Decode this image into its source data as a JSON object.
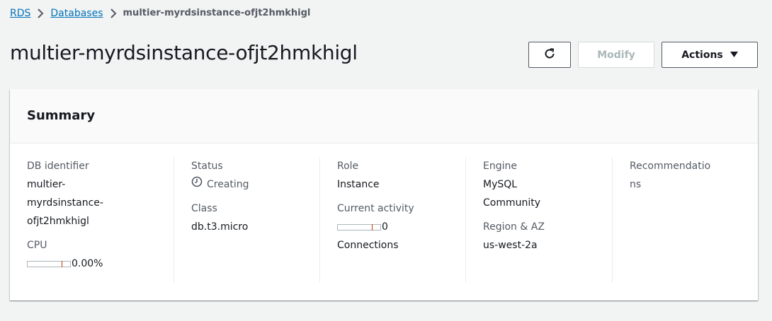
{
  "breadcrumb": {
    "items": [
      "RDS",
      "Databases"
    ],
    "current": "multier-myrdsinstance-ofjt2hmkhigl"
  },
  "page_title": "multier-myrdsinstance-ofjt2hmkhigl",
  "toolbar": {
    "refresh_icon": "refresh-icon",
    "modify_label": "Modify",
    "actions_label": "Actions"
  },
  "summary": {
    "title": "Summary",
    "db_identifier": {
      "label": "DB identifier",
      "lines": [
        "multier-",
        "myrdsinstance-",
        "ofjt2hmkhigl"
      ]
    },
    "cpu": {
      "label": "CPU",
      "value": "0.00%",
      "percent": 0
    },
    "status": {
      "label": "Status",
      "value": "Creating",
      "icon": "clock-icon"
    },
    "class": {
      "label": "Class",
      "value": "db.t3.micro"
    },
    "role": {
      "label": "Role",
      "value": "Instance"
    },
    "current_activity": {
      "label": "Current activity",
      "value": "0",
      "unit": "Connections"
    },
    "engine": {
      "label": "Engine",
      "lines": [
        "MySQL",
        "Community"
      ]
    },
    "region": {
      "label": "Region & AZ",
      "value": "us-west-2a"
    },
    "recommendations": {
      "label_lines": [
        "Recommendatio",
        "ns"
      ]
    }
  },
  "colors": {
    "link": "#0073bb",
    "meter_tick": "#d13212",
    "text": "#16191f",
    "muted": "#545b64"
  }
}
